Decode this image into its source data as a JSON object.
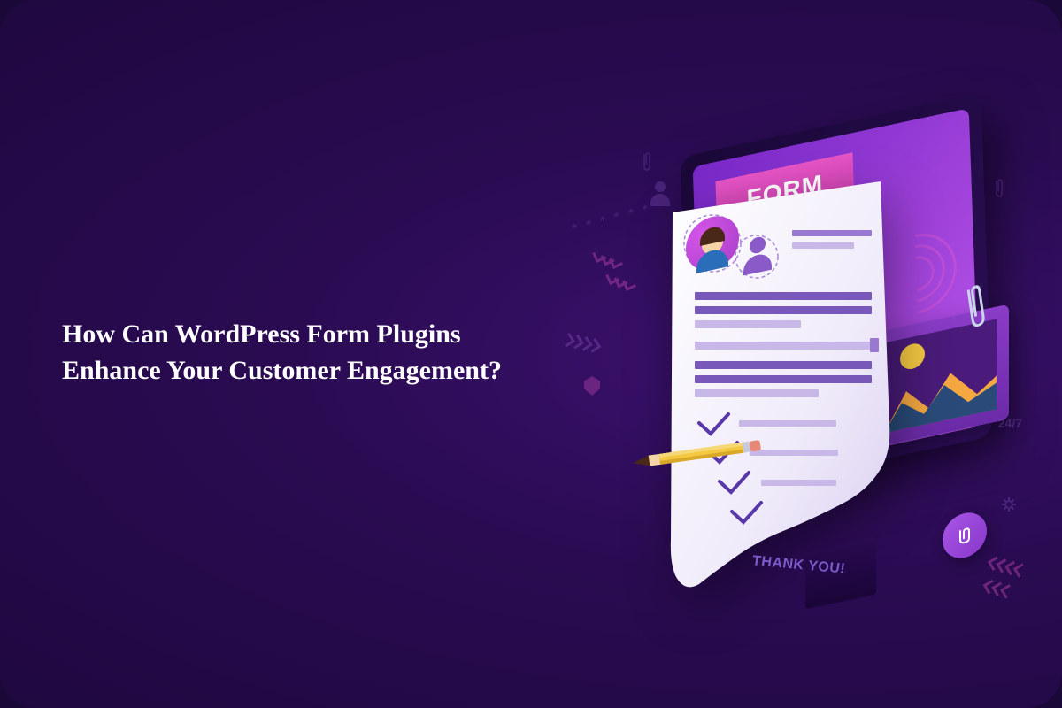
{
  "heading": "How Can WordPress Form Plugins Enhance Your Customer Engagement?",
  "illustration": {
    "formHeader": "FORM",
    "thankYou": "THANK YOU!",
    "decoration247": "24/7"
  },
  "colors": {
    "background": "#2a0b52",
    "accent": "#e855c5",
    "purple": "#8a5bc8",
    "text": "#ffffff"
  }
}
